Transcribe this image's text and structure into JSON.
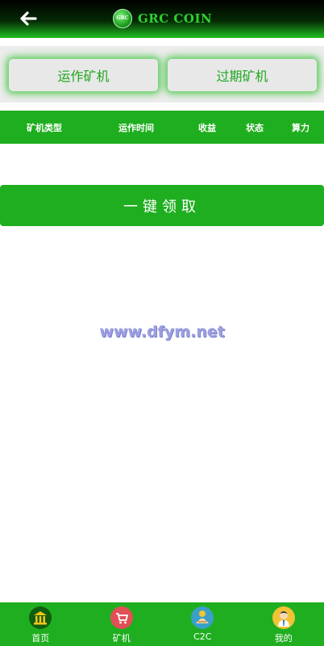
{
  "header": {
    "back_icon": "arrow-left-icon",
    "logo_text": "GRC",
    "title": "GRC COIN"
  },
  "tabs": [
    {
      "label": "运作矿机"
    },
    {
      "label": "过期矿机"
    }
  ],
  "table": {
    "columns": [
      "矿机类型",
      "运作时间",
      "收益",
      "状态",
      "算力"
    ]
  },
  "claim_button": {
    "label": "一键领取"
  },
  "watermark": "www.dfym.net",
  "bottom_nav": [
    {
      "label": "首页",
      "icon": "bank-icon"
    },
    {
      "label": "矿机",
      "icon": "cart-icon"
    },
    {
      "label": "C2C",
      "icon": "handshake-icon"
    },
    {
      "label": "我的",
      "icon": "user-avatar-icon"
    }
  ],
  "colors": {
    "primary_green": "#1fae1f",
    "tab_text_green": "#1fa81f",
    "header_dark": "#000000"
  }
}
